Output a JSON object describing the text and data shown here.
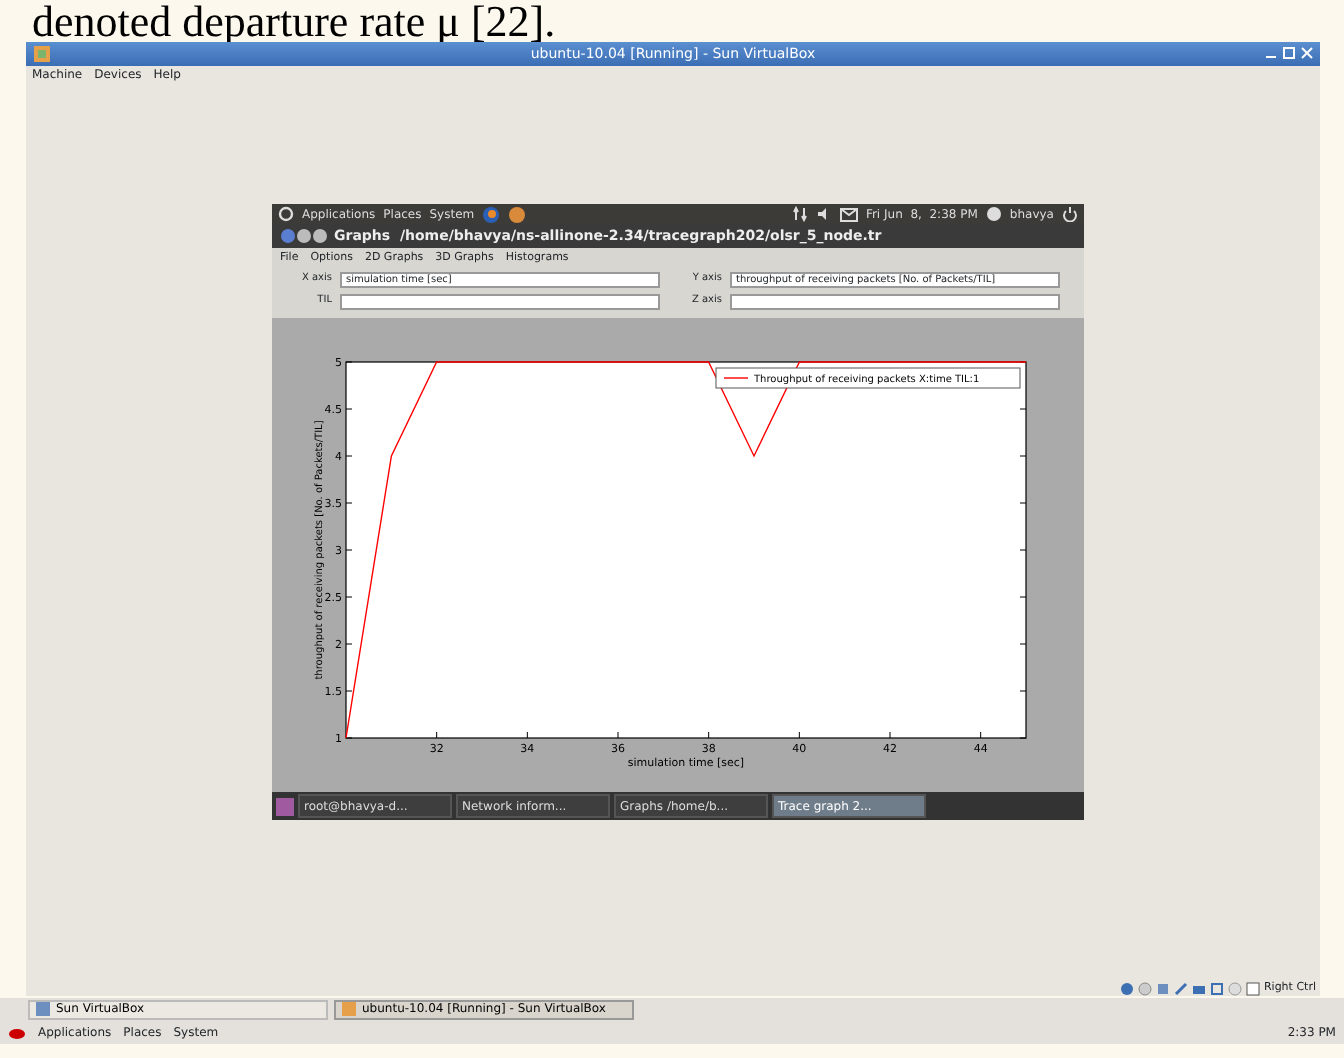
{
  "document_text": "denoted departure rate μ [22].",
  "window": {
    "title": "ubuntu-10.04 [Running] - Sun VirtualBox",
    "menu": [
      "Machine",
      "Devices",
      "Help"
    ],
    "status_text": "Right Ctrl"
  },
  "guest": {
    "panel": {
      "menus": [
        "Applications",
        "Places",
        "System"
      ],
      "clock": "Fri Jun  8,  2:38 PM",
      "user": "bhavya"
    },
    "app": {
      "title": "Graphs  /home/bhavya/ns-allinone-2.34/tracegraph202/olsr_5_node.tr",
      "menu": [
        "File",
        "Options",
        "2D Graphs",
        "3D Graphs",
        "Histograms"
      ],
      "fields": [
        {
          "label": "X axis",
          "value": "simulation time [sec]"
        },
        {
          "label": "Y axis",
          "value": "throughput of receiving packets [No. of Packets/TIL]"
        },
        {
          "label": "TIL"
        },
        {
          "label": "Z axis"
        }
      ],
      "chart_data": {
        "type": "line",
        "xlabel": "simulation time [sec]",
        "ylabel": "throughput of receiving packets [No. of Packets/TIL]",
        "xlim": [
          30,
          45
        ],
        "ylim": [
          1,
          5
        ],
        "xticks": [
          32,
          34,
          36,
          38,
          40,
          42,
          44
        ],
        "yticks": [
          1,
          1.5,
          2,
          2.5,
          3,
          3.5,
          4,
          4.5,
          5
        ],
        "x": [
          30,
          31,
          32,
          38,
          39,
          40,
          45
        ],
        "series": [
          {
            "name": "Throughput of receiving packets X:time TIL:1",
            "color": "#ff0000",
            "values": [
              1,
              4,
              5,
              5,
              4,
              5,
              5
            ]
          }
        ]
      }
    },
    "taskbar": [
      {
        "label": "root@bhavya-d...",
        "selected": false
      },
      {
        "label": "Network inform...",
        "selected": false
      },
      {
        "label": "Graphs  /home/b...",
        "selected": false
      },
      {
        "label": "Trace graph 2...",
        "selected": true
      }
    ]
  },
  "host_taskbar": [
    {
      "label": "Sun VirtualBox",
      "selected": false
    },
    {
      "label": "ubuntu-10.04 [Running] - Sun VirtualBox",
      "selected": true
    }
  ],
  "host_panel": {
    "menus": [
      "Applications",
      "Places",
      "System"
    ],
    "clock": "2:33 PM"
  }
}
